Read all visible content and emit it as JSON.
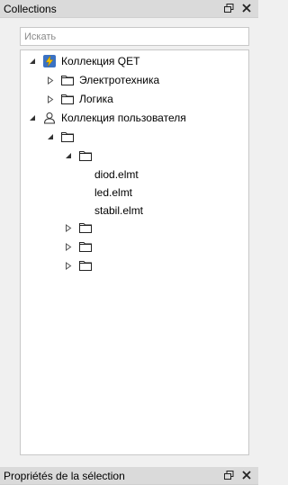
{
  "collections_panel": {
    "title": "Collections",
    "search": {
      "placeholder": "Искать",
      "value": ""
    }
  },
  "tree": {
    "qet_collection": {
      "label": "Коллекция QET",
      "children": [
        {
          "label": "Электротехника"
        },
        {
          "label": "Логика"
        }
      ]
    },
    "user_collection": {
      "label": "Коллекция пользователя",
      "folder": {
        "label": "",
        "subfolder": {
          "label": "",
          "files": [
            "diod.elmt",
            "led.elmt",
            "stabil.elmt"
          ]
        },
        "collapsed_folders": [
          "",
          "",
          ""
        ]
      }
    }
  },
  "properties_panel": {
    "title": "Propriétés de la sélection"
  }
}
